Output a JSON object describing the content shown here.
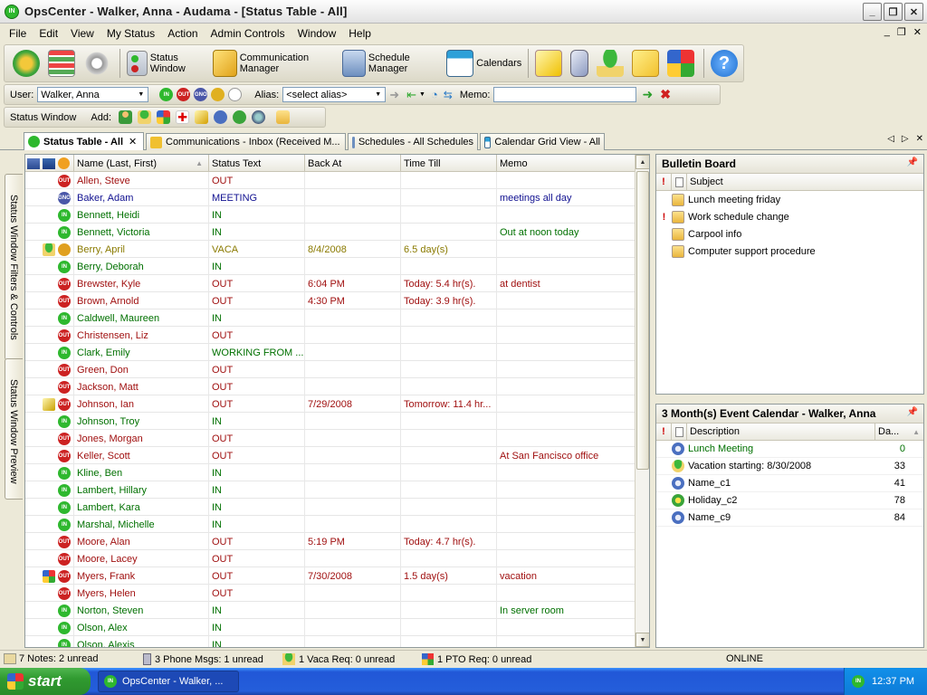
{
  "window": {
    "title": "OpsCenter - Walker, Anna - Audama - [Status Table - All]"
  },
  "menu": [
    "File",
    "Edit",
    "View",
    "My Status",
    "Action",
    "Admin Controls",
    "Window",
    "Help"
  ],
  "toolbar": {
    "status_window": "Status Window",
    "communication_manager": "Communication Manager",
    "schedule_manager": "Schedule Manager",
    "calendars": "Calendars"
  },
  "userbar": {
    "user_label": "User:",
    "user_value": "Walker, Anna",
    "alias_label": "Alias:",
    "alias_value": "<select alias>",
    "memo_label": "Memo:",
    "memo_value": "",
    "status_icons": [
      {
        "label": "IN",
        "color": "#2eb82e"
      },
      {
        "label": "OUT",
        "color": "#cc2222"
      },
      {
        "label": "GNO",
        "color": "#4a57a8"
      }
    ]
  },
  "toolbar3": {
    "status_window": "Status Window",
    "add_label": "Add:"
  },
  "tabs": [
    {
      "label": "Status Table - All",
      "active": true
    },
    {
      "label": "Communications - Inbox (Received M...",
      "active": false
    },
    {
      "label": "Schedules - All Schedules",
      "active": false
    },
    {
      "label": "Calendar Grid View - All",
      "active": false
    }
  ],
  "side_tabs": [
    "Status Window Filters & Controls",
    "Status Window Preview"
  ],
  "colors": {
    "in": "#2eb82e",
    "out": "#cc2222",
    "gno": "#4a57a8",
    "vaca": "#e0a020",
    "in_text": "#007000",
    "out_text": "#a01010",
    "gno_text": "#101090",
    "vaca_text": "#8a7a00"
  },
  "table": {
    "columns": [
      "Name (Last, First)",
      "Status Text",
      "Back At",
      "Time Till",
      "Memo"
    ],
    "rows": [
      {
        "name": "Allen, Steve",
        "status": "OUT",
        "back": "",
        "till": "",
        "memo": "",
        "state": "out"
      },
      {
        "name": "Baker, Adam",
        "status": "MEETING",
        "back": "",
        "till": "",
        "memo": "meetings all day",
        "state": "gno"
      },
      {
        "name": "Bennett, Heidi",
        "status": "IN",
        "back": "",
        "till": "",
        "memo": "",
        "state": "in"
      },
      {
        "name": "Bennett, Victoria",
        "status": "IN",
        "back": "",
        "till": "",
        "memo": "Out at noon today",
        "state": "in"
      },
      {
        "name": "Berry, April",
        "status": "VACA",
        "back": "8/4/2008",
        "till": "6.5  day(s)",
        "memo": "",
        "state": "vaca",
        "extra": "vaca"
      },
      {
        "name": "Berry, Deborah",
        "status": "IN",
        "back": "",
        "till": "",
        "memo": "",
        "state": "in"
      },
      {
        "name": "Brewster, Kyle",
        "status": "OUT",
        "back": "6:04 PM",
        "till": "Today: 5.4 hr(s).",
        "memo": "at dentist",
        "state": "out"
      },
      {
        "name": "Brown, Arnold",
        "status": "OUT",
        "back": "4:30 PM",
        "till": "Today: 3.9 hr(s).",
        "memo": "",
        "state": "out"
      },
      {
        "name": "Caldwell, Maureen",
        "status": "IN",
        "back": "",
        "till": "",
        "memo": "",
        "state": "in"
      },
      {
        "name": "Christensen, Liz",
        "status": "OUT",
        "back": "",
        "till": "",
        "memo": "",
        "state": "out"
      },
      {
        "name": "Clark, Emily",
        "status": "WORKING FROM ...",
        "back": "",
        "till": "",
        "memo": "",
        "state": "in"
      },
      {
        "name": "Green, Don",
        "status": "OUT",
        "back": "",
        "till": "",
        "memo": "",
        "state": "out"
      },
      {
        "name": "Jackson, Matt",
        "status": "OUT",
        "back": "",
        "till": "",
        "memo": "",
        "state": "out"
      },
      {
        "name": "Johnson, Ian",
        "status": "OUT",
        "back": "7/29/2008",
        "till": "Tomorrow: 11.4 hr...",
        "memo": "",
        "state": "out",
        "extra": "note"
      },
      {
        "name": "Johnson, Troy",
        "status": "IN",
        "back": "",
        "till": "",
        "memo": "",
        "state": "in"
      },
      {
        "name": "Jones, Morgan",
        "status": "OUT",
        "back": "",
        "till": "",
        "memo": "",
        "state": "out"
      },
      {
        "name": "Keller, Scott",
        "status": "OUT",
        "back": "",
        "till": "",
        "memo": "At San Fancisco office",
        "state": "out"
      },
      {
        "name": "Kline, Ben",
        "status": "IN",
        "back": "",
        "till": "",
        "memo": "",
        "state": "in"
      },
      {
        "name": "Lambert, Hillary",
        "status": "IN",
        "back": "",
        "till": "",
        "memo": "",
        "state": "in"
      },
      {
        "name": "Lambert, Kara",
        "status": "IN",
        "back": "",
        "till": "",
        "memo": "",
        "state": "in"
      },
      {
        "name": "Marshal, Michelle",
        "status": "IN",
        "back": "",
        "till": "",
        "memo": "",
        "state": "in"
      },
      {
        "name": "Moore, Alan",
        "status": "OUT",
        "back": "5:19 PM",
        "till": "Today: 4.7 hr(s).",
        "memo": "",
        "state": "out"
      },
      {
        "name": "Moore, Lacey",
        "status": "OUT",
        "back": "",
        "till": "",
        "memo": "",
        "state": "out"
      },
      {
        "name": "Myers, Frank",
        "status": "OUT",
        "back": "7/30/2008",
        "till": "1.5  day(s)",
        "memo": "vacation",
        "state": "out",
        "extra": "grid"
      },
      {
        "name": "Myers, Helen",
        "status": "OUT",
        "back": "",
        "till": "",
        "memo": "",
        "state": "out"
      },
      {
        "name": "Norton, Steven",
        "status": "IN",
        "back": "",
        "till": "",
        "memo": "In server room",
        "state": "in"
      },
      {
        "name": "Olson, Alex",
        "status": "IN",
        "back": "",
        "till": "",
        "memo": "",
        "state": "in"
      },
      {
        "name": "Olson, Alexis",
        "status": "IN",
        "back": "",
        "till": "",
        "memo": "",
        "state": "in"
      }
    ]
  },
  "bulletin": {
    "title": "Bulletin Board",
    "column": "Subject",
    "items": [
      {
        "subject": "Lunch meeting friday",
        "important": false
      },
      {
        "subject": "Work schedule change",
        "important": true
      },
      {
        "subject": "Carpool info",
        "important": false
      },
      {
        "subject": "Computer support procedure",
        "important": false
      }
    ]
  },
  "calendar": {
    "title": "3 Month(s) Event Calendar - Walker, Anna",
    "col_desc": "Description",
    "col_days": "Da...",
    "items": [
      {
        "desc": "Lunch Meeting",
        "days": "0",
        "icon": "meeting",
        "green": true
      },
      {
        "desc": "Vacation starting: 8/30/2008",
        "days": "33",
        "icon": "vacation",
        "green": false
      },
      {
        "desc": "Name_c1",
        "days": "41",
        "icon": "meeting",
        "green": false
      },
      {
        "desc": "Holiday_c2",
        "days": "78",
        "icon": "holiday",
        "green": false
      },
      {
        "desc": "Name_c9",
        "days": "84",
        "icon": "meeting",
        "green": false
      }
    ]
  },
  "statusbar": {
    "notes": "7 Notes: 2 unread",
    "phone": "3 Phone Msgs: 1 unread",
    "vaca": "1 Vaca Req: 0 unread",
    "pto": "1 PTO Req: 0 unread",
    "online": "ONLINE"
  },
  "taskbar": {
    "start": "start",
    "item": "OpsCenter - Walker, ...",
    "time": "12:37 PM"
  }
}
